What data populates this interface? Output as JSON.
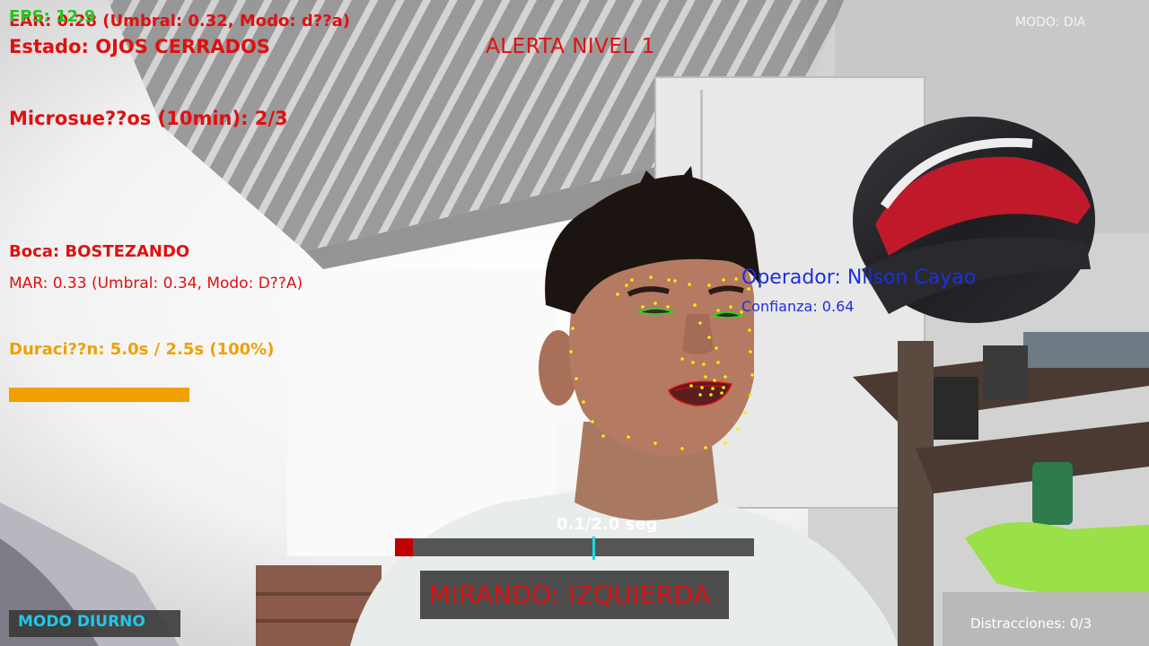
{
  "overlay": {
    "fps": "FPS: 12.9",
    "ear": "EAR: 0.28 (Umbral: 0.32, Modo: d??a)",
    "estado": "Estado: OJOS CERRADOS",
    "alerta": "ALERTA NIVEL 1",
    "modo_top": "MODO: DIA",
    "microsuenos": "Microsue??os (10min): 2/3",
    "boca": "Boca: BOSTEZANDO",
    "mar": "MAR: 0.33 (Umbral: 0.34, Modo: D??A)",
    "duracion": "Duraci??n: 5.0s / 2.5s (100%)",
    "duracion_progress": 1.0,
    "operador": "Operador: Nilson Cayao",
    "confianza": "Confianza: 0.64",
    "distraction_timer": "0.1/2.0 seg",
    "distraction_progress": 0.05,
    "mirando": "MIRANDO: IZQUIERDA",
    "modo_diurno": "MODO DIURNO",
    "distracciones": "Distracciones: 0/3"
  },
  "colors": {
    "alert_red": "#e01010",
    "fps_green": "#1ec81e",
    "duracion_orange": "#f0a000",
    "operator_blue": "#1e2ee0",
    "modo_cyan": "#20c8e6",
    "landmark_yellow": "#f4f000",
    "eye_green": "#20e020",
    "mouth_red": "#e01010"
  },
  "icons": [
    "face-landmarks",
    "eye-contour-icon",
    "mouth-contour-icon"
  ]
}
